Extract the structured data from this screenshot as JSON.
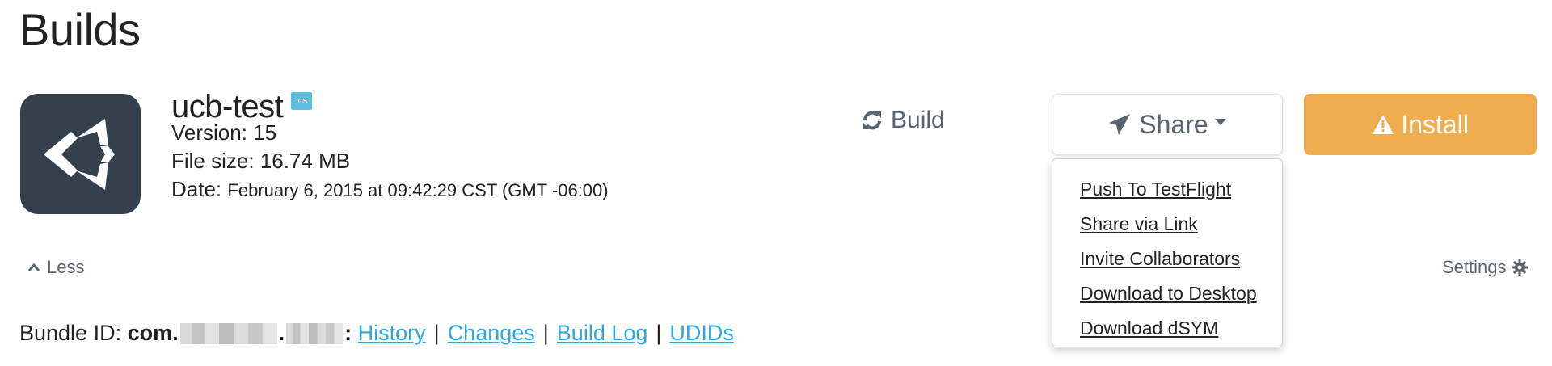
{
  "page": {
    "title": "Builds"
  },
  "build": {
    "project_name": "ucb-test",
    "platform_badge": "ios",
    "version_label": "Version:",
    "version_value": "15",
    "size_label": "File size:",
    "size_value": "16.74 MB",
    "date_label": "Date:",
    "date_value": "February 6, 2015 at 09:42:29 CST (GMT -06:00)"
  },
  "actions": {
    "build_label": "Build",
    "share_label": "Share",
    "install_label": "Install"
  },
  "share_menu": {
    "items": [
      {
        "label": "Push To TestFlight"
      },
      {
        "label": "Share via Link"
      },
      {
        "label": "Invite Collaborators"
      },
      {
        "label": "Download to Desktop"
      },
      {
        "label": "Download dSYM"
      }
    ]
  },
  "footer": {
    "less_label": "Less",
    "settings_label": "Settings",
    "bundle_label": "Bundle ID:",
    "bundle_prefix": "com.",
    "bundle_dot": ".",
    "bundle_colon": ":",
    "links": {
      "history": "History",
      "changes": "Changes",
      "build_log": "Build Log",
      "udids": "UDIDs"
    },
    "separator": "|"
  },
  "icons": {
    "app_icon": "unity-logo-icon",
    "build_icon": "refresh-icon",
    "share_icon": "paper-plane-icon",
    "install_icon": "warning-icon",
    "less_icon": "chevron-up-icon",
    "settings_icon": "gear-icon"
  },
  "colors": {
    "install_bg": "#f0ad4e",
    "badge_bg": "#5bc0de",
    "link": "#2ea7df",
    "icon_bg": "#34404b"
  }
}
